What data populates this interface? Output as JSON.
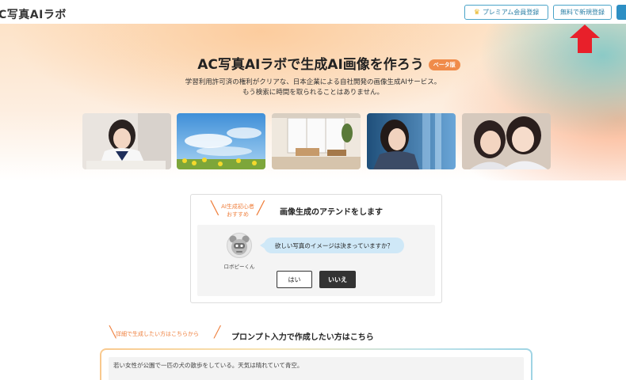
{
  "header": {
    "logo": "C写真AIラボ",
    "premium_button": "プレミアム会員登録",
    "signup_button": "無料で新規登録"
  },
  "hero": {
    "title": "AC写真AIラボで生成AI画像を作ろう",
    "beta_badge": "ベータ版",
    "description_line1": "学習利用許可済の権利がクリアな、日本企業による自社開発の画像生成AIサービス。",
    "description_line2": "もう検索に時間を取られることはありません。"
  },
  "attend": {
    "beginner_line1": "AI生成初心者",
    "beginner_line2": "おすすめ",
    "title": "画像生成のアテンドをします",
    "robot_name": "ロボピーくん",
    "question": "欲しい写真のイメージは決まっていますか？",
    "yes_button": "はい",
    "no_button": "いいえ"
  },
  "prompt": {
    "detail_note": "詳細で生成したい方はこちらから",
    "title": "プロンプト入力で作成したい方はこちら",
    "input_value": "若い女性が公園で一匹の犬の散歩をしている。天気は晴れていて青空。"
  },
  "colors": {
    "accent_orange": "#f08b4a",
    "link_blue": "#2b7fa6",
    "arrow_red": "#e8202a"
  }
}
